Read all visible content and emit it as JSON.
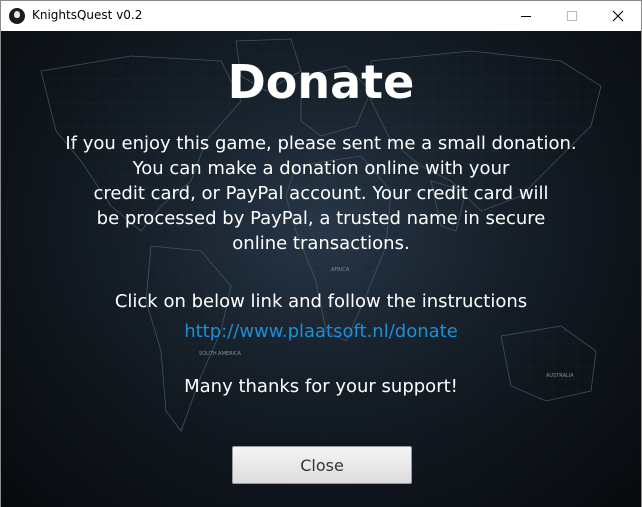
{
  "window": {
    "title": "KnightsQuest v0.2",
    "icons": {
      "app": "knight-helmet-icon",
      "minimize": "minimize-icon",
      "maximize": "maximize-icon",
      "close": "close-icon"
    }
  },
  "dialog": {
    "heading": "Donate",
    "paragraph_lines": [
      "If you enjoy this game, please sent me a small donation.",
      "You can make a donation online with your",
      "credit card, or PayPal account. Your credit card will",
      "be processed by PayPal, a trusted name in secure",
      "online transactions."
    ],
    "instruction": "Click on below link and follow the instructions",
    "link": "http://www.plaatsoft.nl/donate",
    "thanks": "Many thanks for your support!",
    "close_label": "Close",
    "map_labels": [
      "AFRICA",
      "SOUTH AMERICA",
      "AUSTRALIA"
    ]
  },
  "colors": {
    "link": "#1d8fd6",
    "text": "#ffffff",
    "background": "#121a22"
  }
}
